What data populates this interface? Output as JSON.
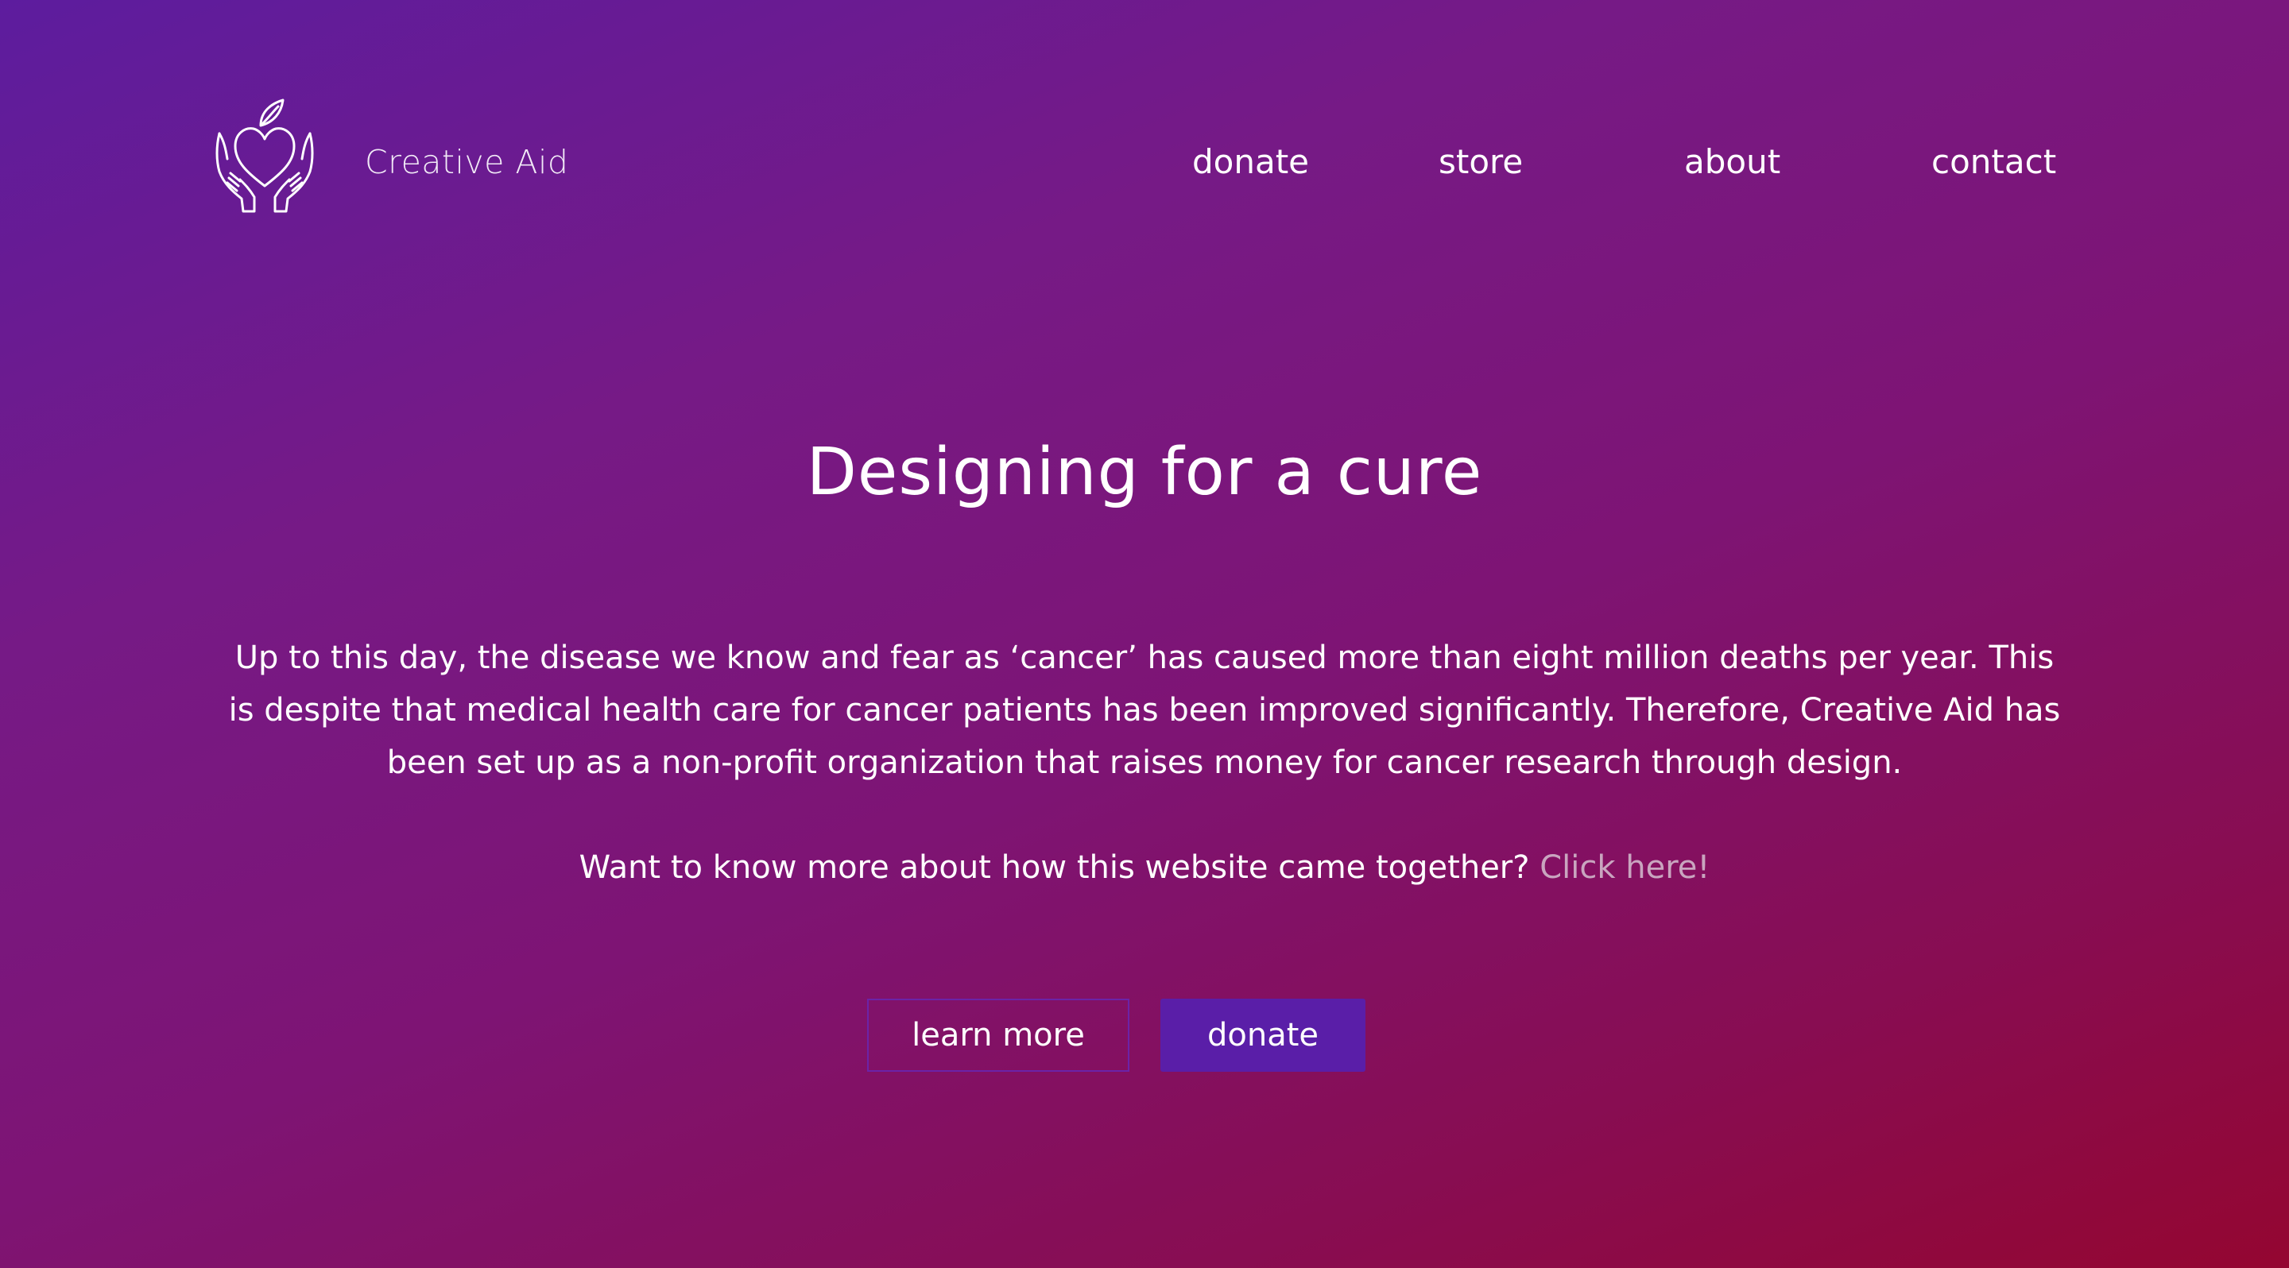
{
  "header": {
    "logo_icon": "hands-holding-heart-icon",
    "brand": "Creative Aid",
    "nav": {
      "donate": "donate",
      "store": "store",
      "about": "about",
      "contact": "contact"
    }
  },
  "hero": {
    "headline": "Designing for a cure",
    "intro": "Up to this day, the disease we know and fear as ‘cancer’ has caused more than eight million deaths per year. This is despite that medical health care for cancer patients has been improved significantly. Therefore, Creative Aid has been set up as a non-profit organization that raises money for cancer research through design.",
    "more_prompt": "Want to know more about how this website came together?",
    "more_link": "Click here!"
  },
  "buttons": {
    "learn_more": "learn more",
    "donate": "donate"
  },
  "colors": {
    "gradient_start": "#5d1c9e",
    "gradient_end": "#940631",
    "accent_button": "#5a1ea8",
    "link_color": "#c9a5bf"
  }
}
